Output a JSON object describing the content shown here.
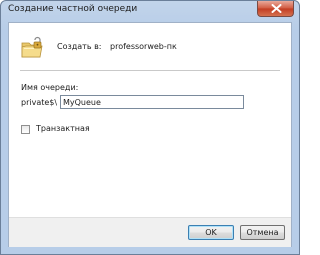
{
  "window": {
    "title": "Создание частной очереди"
  },
  "create": {
    "label": "Создать в:",
    "value": "professorweb-пк"
  },
  "queue_name": {
    "label": "Имя очереди:",
    "prefix": "private$\\",
    "value": "MyQueue"
  },
  "transactional": {
    "label": "Транзактная",
    "checked": false
  },
  "buttons": {
    "ok": "OK",
    "cancel": "Отмена"
  },
  "icons": {
    "queue": "private-queue-folder-icon",
    "close": "close-icon"
  },
  "colors": {
    "title_bar": "#b7cde8",
    "close_button": "#c94a30",
    "default_button_border": "#3c7fb1"
  }
}
